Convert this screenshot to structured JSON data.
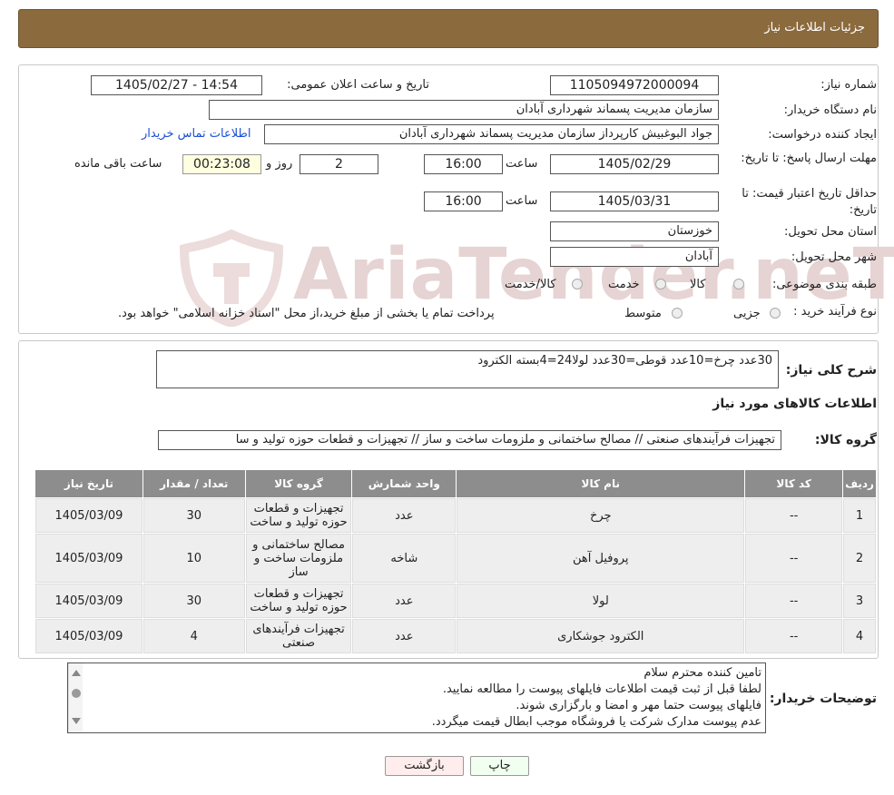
{
  "header": {
    "title": "جزئیات اطلاعات نیاز"
  },
  "watermark": "AriaTender.neT",
  "info": {
    "need_number_label": "شماره نیاز:",
    "need_number": "1105094972000094",
    "announce_label": "تاریخ و ساعت اعلان عمومی:",
    "announce_value": "1405/02/27 - 14:54",
    "buyer_org_label": "نام دستگاه خریدار:",
    "buyer_org": "سازمان مدیریت پسماند شهرداری آبادان",
    "creator_label": "ایجاد کننده درخواست:",
    "creator": "جواد البوغبیش کارپرداز سازمان مدیریت پسماند شهرداری آبادان",
    "contact_link": "اطلاعات تماس خریدار",
    "deadline_label": "مهلت ارسال پاسخ: تا تاریخ:",
    "deadline_date": "1405/02/29",
    "time_label": "ساعت",
    "deadline_time": "16:00",
    "days_value": "2",
    "days_label": "روز و",
    "remaining_time": "00:23:08",
    "remaining_label": "ساعت باقی مانده",
    "validity_label": "حداقل تاریخ اعتبار قیمت: تا تاریخ:",
    "validity_date": "1405/03/31",
    "validity_time": "16:00",
    "province_label": "استان محل تحویل:",
    "province": "خوزستان",
    "city_label": "شهر محل تحویل:",
    "city": "آبادان",
    "category_label": "طبقه بندی موضوعی:",
    "category_options": [
      "کالا",
      "خدمت",
      "کالا/خدمت"
    ],
    "process_label": "نوع فرآیند خرید :",
    "process_options": [
      "جزیی",
      "متوسط"
    ],
    "process_note": "پرداخت تمام یا بخشی از مبلغ خرید،از محل \"اسناد خزانه اسلامی\" خواهد بود."
  },
  "description": {
    "label": "شرح کلی نیاز:",
    "text": "30عدد چرخ=10عدد قوطی=30عدد لولا24=4بسته الکترود",
    "goods_title": "اطلاعات کالاهای مورد نیاز",
    "group_label": "گروه کالا:",
    "group_value": "تجهیزات فرآیندهای صنعتی // مصالح ساختمانی و ملزومات ساخت و ساز // تجهیزات و قطعات حوزه تولید و سا"
  },
  "table": {
    "headers": [
      "ردیف",
      "کد کالا",
      "نام کالا",
      "واحد شمارش",
      "گروه کالا",
      "تعداد / مقدار",
      "تاریخ نیاز"
    ],
    "rows": [
      [
        "1",
        "--",
        "چرخ",
        "عدد",
        "تجهیزات و قطعات حوزه تولید و ساخت",
        "30",
        "1405/03/09"
      ],
      [
        "2",
        "--",
        "پروفیل آهن",
        "شاخه",
        "مصالح ساختمانی و ملزومات ساخت و ساز",
        "10",
        "1405/03/09"
      ],
      [
        "3",
        "--",
        "لولا",
        "عدد",
        "تجهیزات و قطعات حوزه تولید و ساخت",
        "30",
        "1405/03/09"
      ],
      [
        "4",
        "--",
        "الکترود جوشکاری",
        "عدد",
        "تجهیزات فرآیندهای صنعتی",
        "4",
        "1405/03/09"
      ]
    ]
  },
  "buyer_notes": {
    "label": "توضیحات خریدار:",
    "lines": [
      "تامین کننده محترم سلام",
      "لطفا قبل از ثبت قیمت اطلاعات فایلهای پیوست را مطالعه نمایید.",
      "فایلهای پیوست حتما مهر و امضا و بارگزاری شوند.",
      "عدم پیوست مدارک شرکت یا فروشگاه موجب ابطال قیمت میگردد."
    ]
  },
  "buttons": {
    "print": "چاپ",
    "back": "بازگشت"
  }
}
